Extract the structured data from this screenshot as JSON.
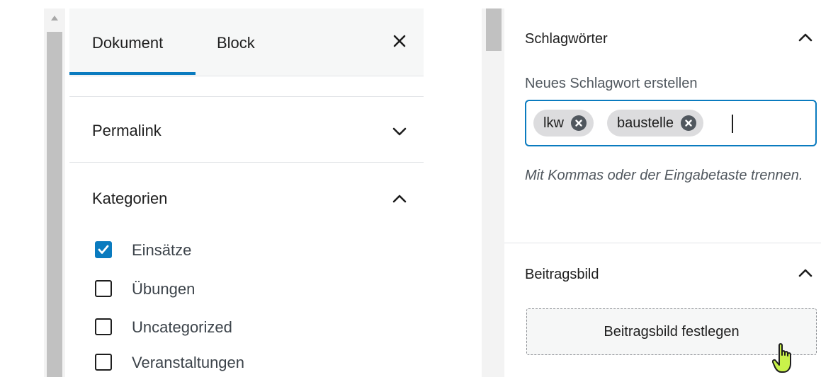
{
  "tabs": {
    "document": "Dokument",
    "block": "Block"
  },
  "permalink": {
    "title": "Permalink"
  },
  "categories": {
    "title": "Kategorien",
    "items": [
      {
        "label": "Einsätze",
        "checked": true
      },
      {
        "label": "Übungen",
        "checked": false
      },
      {
        "label": "Uncategorized",
        "checked": false
      },
      {
        "label": "Veranstaltungen",
        "checked": false
      }
    ]
  },
  "tags": {
    "title": "Schlagwörter",
    "field_label": "Neues Schlagwort erstellen",
    "chips": [
      "lkw",
      "baustelle"
    ],
    "help": "Mit Kommas oder der Eingabetaste trennen."
  },
  "featured_image": {
    "title": "Beitragsbild",
    "button": "Beitragsbild festlegen"
  },
  "colors": {
    "accent": "#0a7bbf",
    "chip": "#dcdcde",
    "chip_remove": "#50575e"
  },
  "icons": {
    "close": "close-icon",
    "expand": "chevron-down-icon",
    "collapse": "chevron-up-icon",
    "cursor": "hand-pointer-icon"
  }
}
